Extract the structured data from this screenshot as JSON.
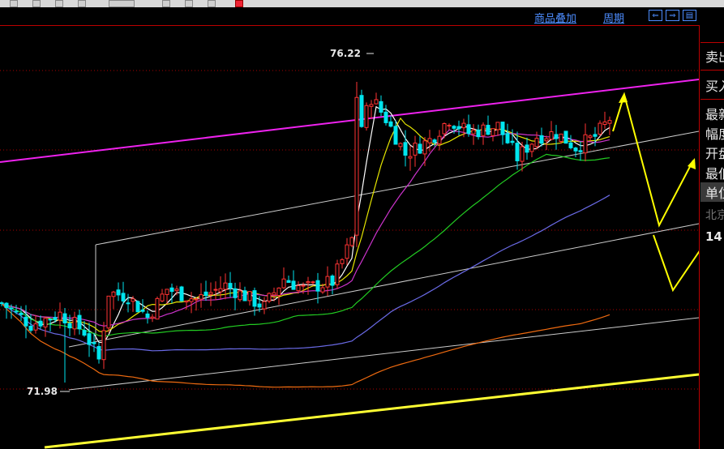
{
  "toolbar": {
    "overlay_label": "商品叠加",
    "period_label": "周期"
  },
  "sidebar": {
    "items": [
      "卖出",
      "买入",
      "最新",
      "幅度",
      "开盘",
      "最低",
      "单位",
      "北京",
      "14"
    ]
  },
  "chart_data": {
    "type": "candlestick",
    "high_label": "76.22",
    "low_label": "71.98",
    "ylim": [
      70.8,
      77.3
    ],
    "colors": {
      "up": "#ff3333",
      "down": "#00e5ee",
      "ma5": "#ffffff",
      "ma10": "#e6e600",
      "ma20": "#cc33cc",
      "ma40": "#22cc22",
      "ma60": "#6a6ae6",
      "ma120": "#ee6a10",
      "channel_upper": "#ee22ee",
      "channel_lower": "#ffff33",
      "channel": "#cccccc",
      "projection": "#ffff00",
      "grid": "#aa0000"
    }
  }
}
